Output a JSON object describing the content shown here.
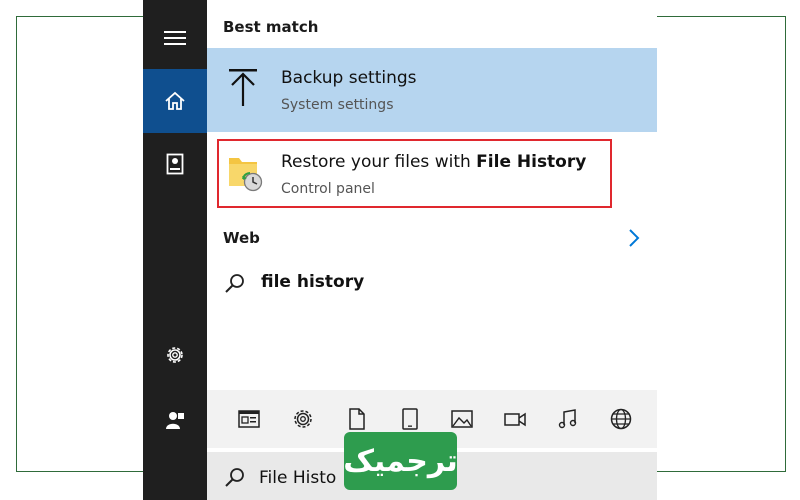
{
  "sections": {
    "best_match_label": "Best match",
    "web_label": "Web"
  },
  "best_match": {
    "title": "Backup settings",
    "subtitle": "System settings"
  },
  "second_result": {
    "title_prefix": "Restore your files with ",
    "title_bold": "File History",
    "subtitle": "Control panel"
  },
  "web_suggestion": {
    "text": "file history"
  },
  "search_bar": {
    "value": "File Histo"
  },
  "sidebar": {
    "items": [
      "menu-icon",
      "home-icon",
      "documents-icon",
      "settings-icon",
      "user-icon"
    ]
  },
  "filters": [
    "apps-icon",
    "settings-icon",
    "document-icon",
    "tablet-icon",
    "photos-icon",
    "video-icon",
    "music-icon",
    "web-icon"
  ],
  "watermark": {
    "text": "ترجمیک"
  },
  "colors": {
    "sidebar_bg": "#1f1f1f",
    "active_tab": "#0f4f8f",
    "selected_row": "#b6d5ef",
    "highlight_border": "#e0282e",
    "accent_blue": "#0078d7",
    "watermark_green": "#2e9c4e",
    "frame_green": "#2f6b3a"
  }
}
